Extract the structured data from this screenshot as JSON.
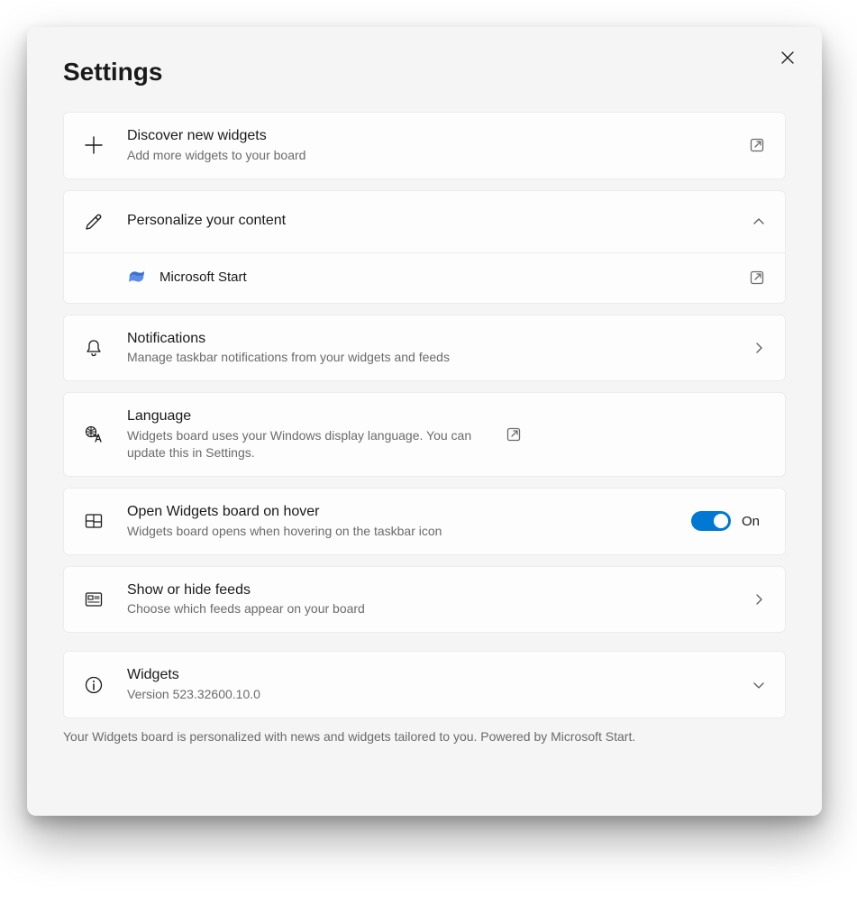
{
  "title": "Settings",
  "rows": {
    "discover": {
      "title": "Discover new widgets",
      "sub": "Add more widgets to your board"
    },
    "personalize": {
      "title": "Personalize your content",
      "sub_item": "Microsoft Start"
    },
    "notifications": {
      "title": "Notifications",
      "sub": "Manage taskbar notifications from your widgets and feeds"
    },
    "language": {
      "title": "Language",
      "sub": "Widgets board uses your Windows display language. You can update this in Settings."
    },
    "hover": {
      "title": "Open Widgets board on hover",
      "sub": "Widgets board opens when hovering on the taskbar icon",
      "toggle_state": "On"
    },
    "feeds": {
      "title": "Show or hide feeds",
      "sub": "Choose which feeds appear on your board"
    },
    "widgets_version": {
      "title": "Widgets",
      "sub": "Version 523.32600.10.0"
    }
  },
  "footer": "Your Widgets board is personalized with news and widgets tailored to you. Powered by Microsoft Start."
}
